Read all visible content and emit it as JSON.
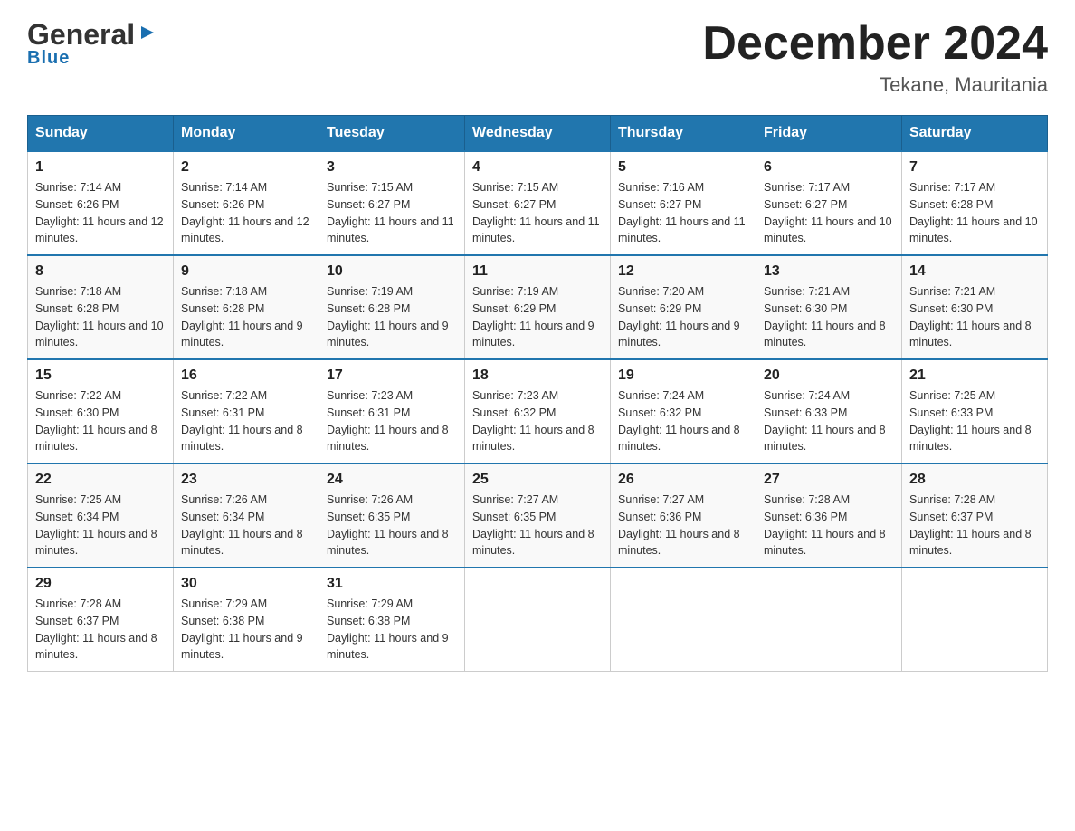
{
  "header": {
    "logo": {
      "general": "General",
      "arrow_symbol": "▶",
      "blue": "Blue"
    },
    "title": "December 2024",
    "location": "Tekane, Mauritania"
  },
  "days_of_week": [
    "Sunday",
    "Monday",
    "Tuesday",
    "Wednesday",
    "Thursday",
    "Friday",
    "Saturday"
  ],
  "weeks": [
    [
      {
        "day": "1",
        "sunrise": "7:14 AM",
        "sunset": "6:26 PM",
        "daylight": "11 hours and 12 minutes."
      },
      {
        "day": "2",
        "sunrise": "7:14 AM",
        "sunset": "6:26 PM",
        "daylight": "11 hours and 12 minutes."
      },
      {
        "day": "3",
        "sunrise": "7:15 AM",
        "sunset": "6:27 PM",
        "daylight": "11 hours and 11 minutes."
      },
      {
        "day": "4",
        "sunrise": "7:15 AM",
        "sunset": "6:27 PM",
        "daylight": "11 hours and 11 minutes."
      },
      {
        "day": "5",
        "sunrise": "7:16 AM",
        "sunset": "6:27 PM",
        "daylight": "11 hours and 11 minutes."
      },
      {
        "day": "6",
        "sunrise": "7:17 AM",
        "sunset": "6:27 PM",
        "daylight": "11 hours and 10 minutes."
      },
      {
        "day": "7",
        "sunrise": "7:17 AM",
        "sunset": "6:28 PM",
        "daylight": "11 hours and 10 minutes."
      }
    ],
    [
      {
        "day": "8",
        "sunrise": "7:18 AM",
        "sunset": "6:28 PM",
        "daylight": "11 hours and 10 minutes."
      },
      {
        "day": "9",
        "sunrise": "7:18 AM",
        "sunset": "6:28 PM",
        "daylight": "11 hours and 9 minutes."
      },
      {
        "day": "10",
        "sunrise": "7:19 AM",
        "sunset": "6:28 PM",
        "daylight": "11 hours and 9 minutes."
      },
      {
        "day": "11",
        "sunrise": "7:19 AM",
        "sunset": "6:29 PM",
        "daylight": "11 hours and 9 minutes."
      },
      {
        "day": "12",
        "sunrise": "7:20 AM",
        "sunset": "6:29 PM",
        "daylight": "11 hours and 9 minutes."
      },
      {
        "day": "13",
        "sunrise": "7:21 AM",
        "sunset": "6:30 PM",
        "daylight": "11 hours and 8 minutes."
      },
      {
        "day": "14",
        "sunrise": "7:21 AM",
        "sunset": "6:30 PM",
        "daylight": "11 hours and 8 minutes."
      }
    ],
    [
      {
        "day": "15",
        "sunrise": "7:22 AM",
        "sunset": "6:30 PM",
        "daylight": "11 hours and 8 minutes."
      },
      {
        "day": "16",
        "sunrise": "7:22 AM",
        "sunset": "6:31 PM",
        "daylight": "11 hours and 8 minutes."
      },
      {
        "day": "17",
        "sunrise": "7:23 AM",
        "sunset": "6:31 PM",
        "daylight": "11 hours and 8 minutes."
      },
      {
        "day": "18",
        "sunrise": "7:23 AM",
        "sunset": "6:32 PM",
        "daylight": "11 hours and 8 minutes."
      },
      {
        "day": "19",
        "sunrise": "7:24 AM",
        "sunset": "6:32 PM",
        "daylight": "11 hours and 8 minutes."
      },
      {
        "day": "20",
        "sunrise": "7:24 AM",
        "sunset": "6:33 PM",
        "daylight": "11 hours and 8 minutes."
      },
      {
        "day": "21",
        "sunrise": "7:25 AM",
        "sunset": "6:33 PM",
        "daylight": "11 hours and 8 minutes."
      }
    ],
    [
      {
        "day": "22",
        "sunrise": "7:25 AM",
        "sunset": "6:34 PM",
        "daylight": "11 hours and 8 minutes."
      },
      {
        "day": "23",
        "sunrise": "7:26 AM",
        "sunset": "6:34 PM",
        "daylight": "11 hours and 8 minutes."
      },
      {
        "day": "24",
        "sunrise": "7:26 AM",
        "sunset": "6:35 PM",
        "daylight": "11 hours and 8 minutes."
      },
      {
        "day": "25",
        "sunrise": "7:27 AM",
        "sunset": "6:35 PM",
        "daylight": "11 hours and 8 minutes."
      },
      {
        "day": "26",
        "sunrise": "7:27 AM",
        "sunset": "6:36 PM",
        "daylight": "11 hours and 8 minutes."
      },
      {
        "day": "27",
        "sunrise": "7:28 AM",
        "sunset": "6:36 PM",
        "daylight": "11 hours and 8 minutes."
      },
      {
        "day": "28",
        "sunrise": "7:28 AM",
        "sunset": "6:37 PM",
        "daylight": "11 hours and 8 minutes."
      }
    ],
    [
      {
        "day": "29",
        "sunrise": "7:28 AM",
        "sunset": "6:37 PM",
        "daylight": "11 hours and 8 minutes."
      },
      {
        "day": "30",
        "sunrise": "7:29 AM",
        "sunset": "6:38 PM",
        "daylight": "11 hours and 9 minutes."
      },
      {
        "day": "31",
        "sunrise": "7:29 AM",
        "sunset": "6:38 PM",
        "daylight": "11 hours and 9 minutes."
      },
      null,
      null,
      null,
      null
    ]
  ]
}
